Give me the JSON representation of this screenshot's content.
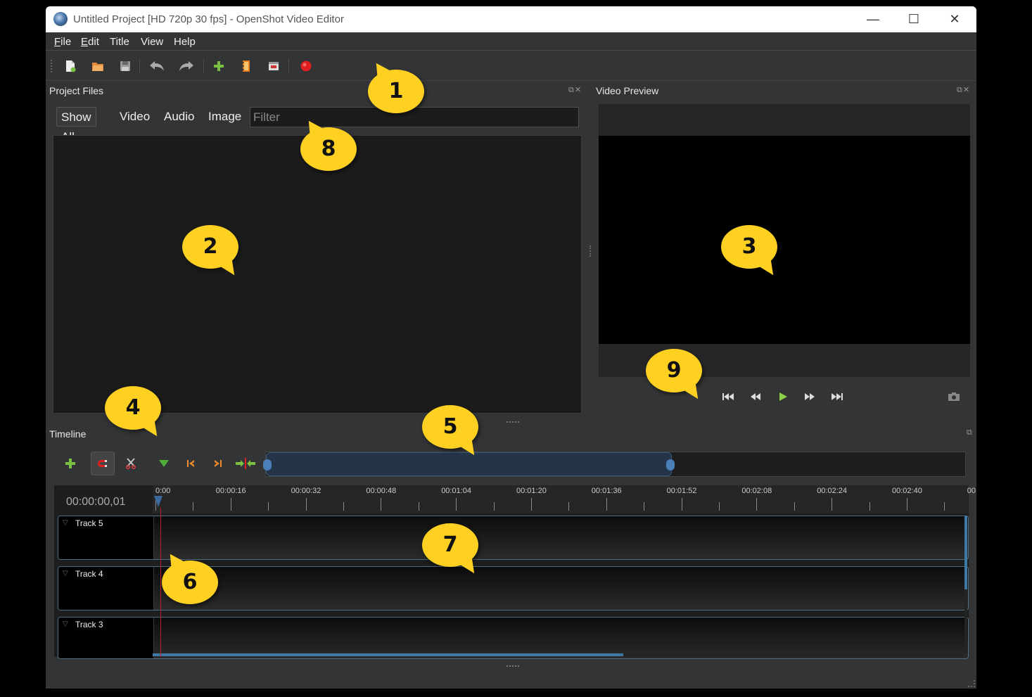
{
  "window": {
    "title": "Untitled Project [HD 720p 30 fps] - OpenShot Video Editor",
    "minimize": "—",
    "maximize": "☐",
    "close": "✕"
  },
  "menu": {
    "file": {
      "mnemonic": "F",
      "rest": "ile"
    },
    "edit": {
      "mnemonic": "E",
      "rest": "dit"
    },
    "title": "Title",
    "view": "View",
    "help": "Help"
  },
  "project_files": {
    "title": "Project Files",
    "tabs": [
      "Show All",
      "Video",
      "Audio",
      "Image"
    ],
    "filter_placeholder": "Filter"
  },
  "video_preview": {
    "title": "Video Preview"
  },
  "timeline": {
    "title": "Timeline",
    "timecode": "00:00:00,01",
    "ruler_labels": [
      "0:00",
      "00:00:16",
      "00:00:32",
      "00:00:48",
      "00:01:04",
      "00:01:20",
      "00:01:36",
      "00:01:52",
      "00:02:08",
      "00:02:24",
      "00:02:40",
      "00"
    ],
    "tracks": [
      "Track 5",
      "Track 4",
      "Track 3"
    ],
    "zoom_selection": {
      "start": 0.0,
      "end": 0.58
    },
    "horizontal_scroll_fraction": 0.58
  },
  "callouts": [
    "1",
    "2",
    "3",
    "4",
    "5",
    "6",
    "7",
    "8",
    "9"
  ],
  "icons": {
    "toolbar": [
      "new-project-icon",
      "open-project-icon",
      "save-project-icon",
      "undo-icon",
      "redo-icon",
      "import-files-icon",
      "choose-profile-icon",
      "fullscreen-icon",
      "export-video-icon"
    ],
    "preview": [
      "jump-start-icon",
      "rewind-icon",
      "play-icon",
      "fast-forward-icon",
      "jump-end-icon",
      "snapshot-icon"
    ],
    "timeline": [
      "add-track-icon",
      "snapping-icon",
      "razor-icon",
      "add-marker-icon",
      "previous-marker-icon",
      "next-marker-icon",
      "center-playhead-icon"
    ]
  },
  "colors": {
    "accent": "#3d7aa6",
    "playhead": "#c21d2c",
    "callout": "#fdd022",
    "record": "#e02020",
    "add": "#7bc043"
  }
}
